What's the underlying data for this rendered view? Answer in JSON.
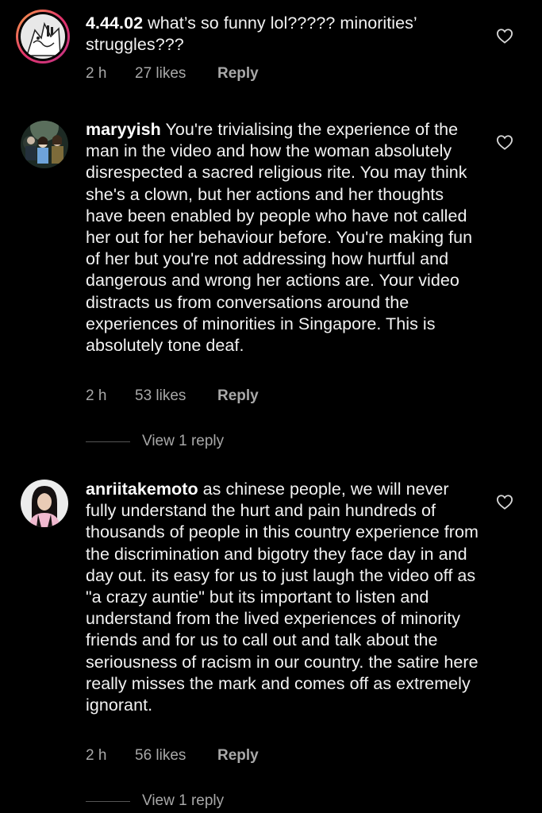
{
  "comments": [
    {
      "username": "4.44.02",
      "text": "what’s so funny lol????? minorities’ struggles???",
      "time": "2 h",
      "likes": "27 likes",
      "reply_label": "Reply"
    },
    {
      "username": "maryyish",
      "text": "You're trivialising the experience of the man in the video and how the woman absolutely disrespected a sacred religious rite. You may think she's a clown, but her actions and her thoughts have been enabled by people who have not called her out for her behaviour before. You're making fun of her but you're not addressing how hurtful and dangerous and wrong her actions are. Your video distracts us from conversations around the experiences of minorities in Singapore. This is absolutely tone deaf.",
      "time": "2 h",
      "likes": "53 likes",
      "reply_label": "Reply",
      "view_replies": "View 1 reply"
    },
    {
      "username": "anriitakemoto",
      "text": "as chinese people, we will never fully understand the hurt and pain hundreds of thousands of people in this country experience from the discrimination and bigotry they face day in and day out. its easy for us to just laugh the video off as \"a crazy auntie\" but its important to listen and understand from the lived experiences of minority friends and for us to call out and talk about the seriousness of racism in our country. the satire here really misses the mark and comes off as extremely ignorant.",
      "time": "2 h",
      "likes": "56 likes",
      "reply_label": "Reply",
      "view_replies": "View 1 reply"
    }
  ],
  "icons": {
    "like": "heart-outline-icon",
    "avatar": "user-avatar-icon"
  },
  "colors": {
    "background": "#000000",
    "text": "#f2f2f2",
    "secondary": "#a8a8a8",
    "story_ring_start": "#f9a248",
    "story_ring_end": "#c13584"
  }
}
